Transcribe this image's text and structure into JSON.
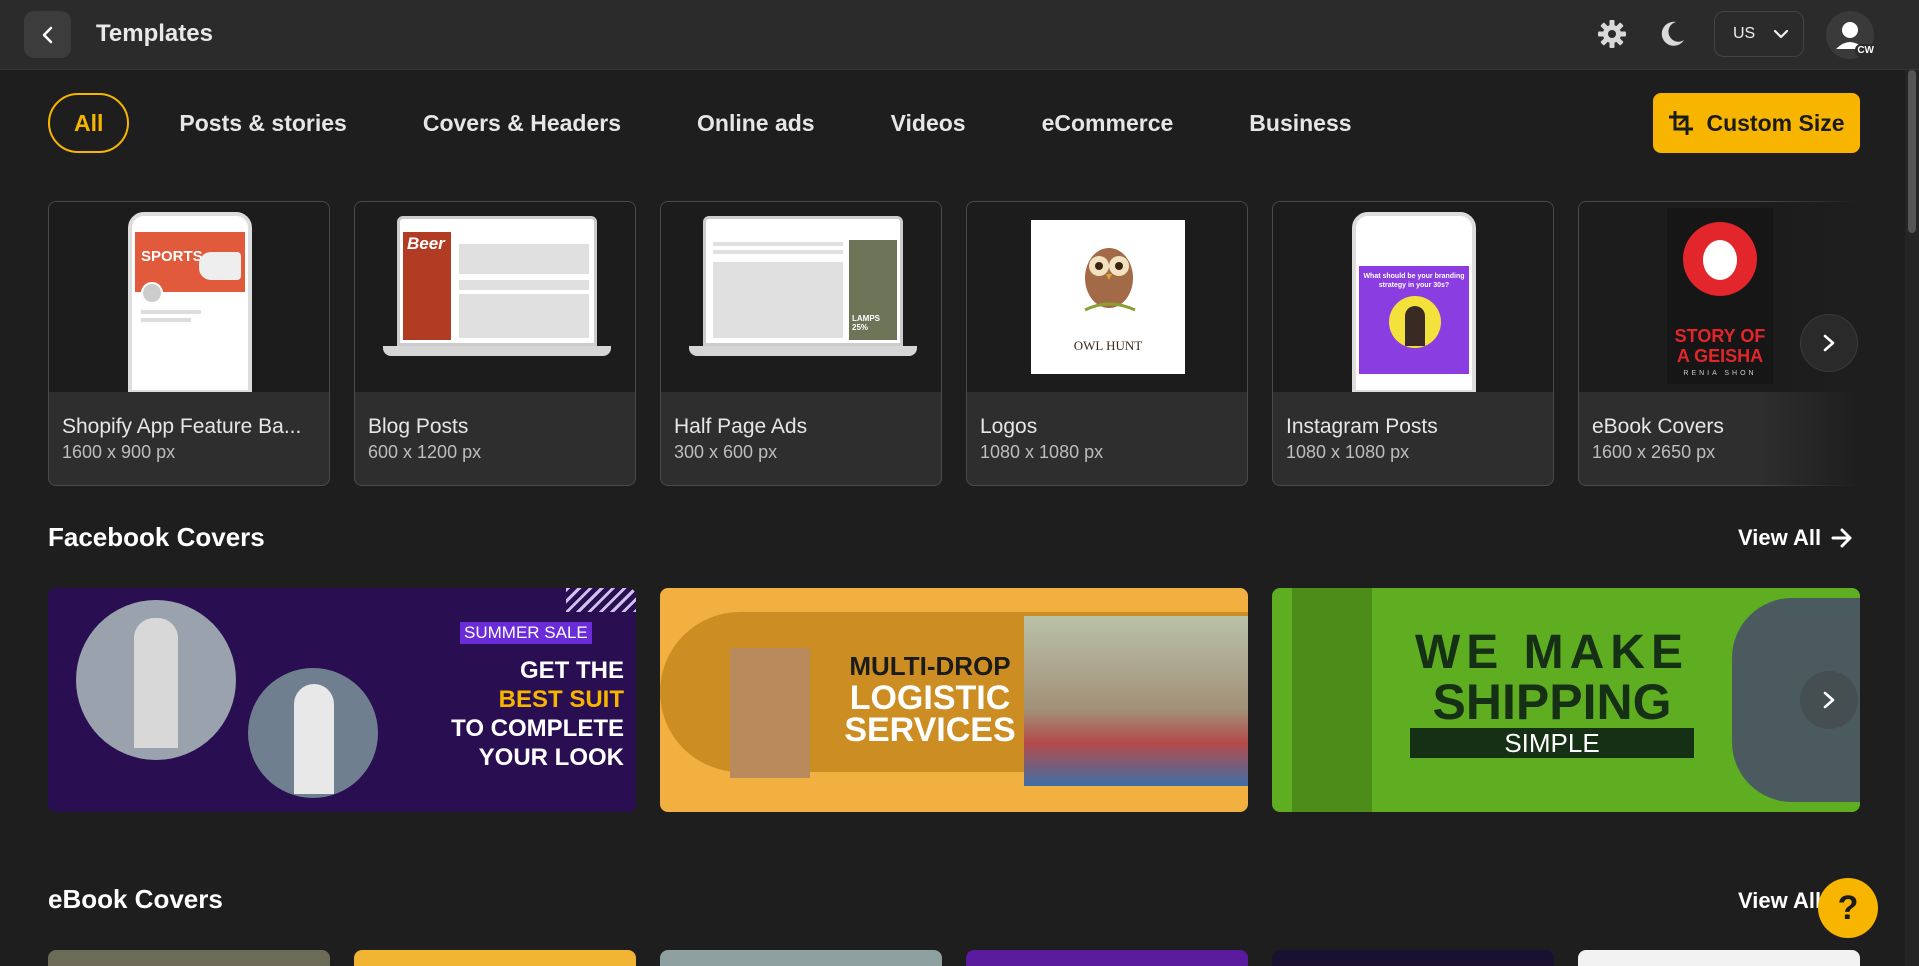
{
  "header": {
    "title": "Templates",
    "country": "US",
    "avatar_initials": "CW"
  },
  "tabs": [
    {
      "label": "All",
      "active": true
    },
    {
      "label": "Posts & stories"
    },
    {
      "label": "Covers & Headers"
    },
    {
      "label": "Online ads"
    },
    {
      "label": "Videos"
    },
    {
      "label": "eCommerce"
    },
    {
      "label": "Business"
    }
  ],
  "custom_size_label": "Custom Size",
  "formats": [
    {
      "name": "Shopify App Feature Ba...",
      "size": "1600 x 900 px",
      "thumb_text": "SPORTS"
    },
    {
      "name": "Blog Posts",
      "size": "600 x 1200 px",
      "thumb_text": "Beer"
    },
    {
      "name": "Half Page Ads",
      "size": "300 x 600 px",
      "thumb_text": "LAMPS 25%"
    },
    {
      "name": "Logos",
      "size": "1080 x 1080 px",
      "thumb_text": "OWL HUNT"
    },
    {
      "name": "Instagram Posts",
      "size": "1080 x 1080 px",
      "thumb_text": "What should be your branding strategy in your 30s?"
    },
    {
      "name": "eBook Covers",
      "size": "1600 x 2650 px",
      "thumb_text": "STORY OF A GEISHA",
      "thumb_author": "RENIA SHON"
    }
  ],
  "facebook_covers": {
    "title": "Facebook Covers",
    "view_all": "View All",
    "items": [
      {
        "tag": "SUMMER SALE",
        "line1": "GET THE",
        "line2": "BEST SUIT",
        "line3": "TO COMPLETE",
        "line4": "YOUR LOOK"
      },
      {
        "line1": "MULTI-DROP",
        "line2": "LOGISTIC",
        "line3": "SERVICES"
      },
      {
        "line1": "WE MAKE",
        "line2": "SHIPPING",
        "line3": "SIMPLE"
      }
    ]
  },
  "ebook_covers": {
    "title": "eBook Covers",
    "view_all": "View All"
  },
  "help_label": "?",
  "colors": {
    "accent": "#f7b500",
    "background": "#1e1e1e",
    "topbar": "#2b2b2b"
  }
}
